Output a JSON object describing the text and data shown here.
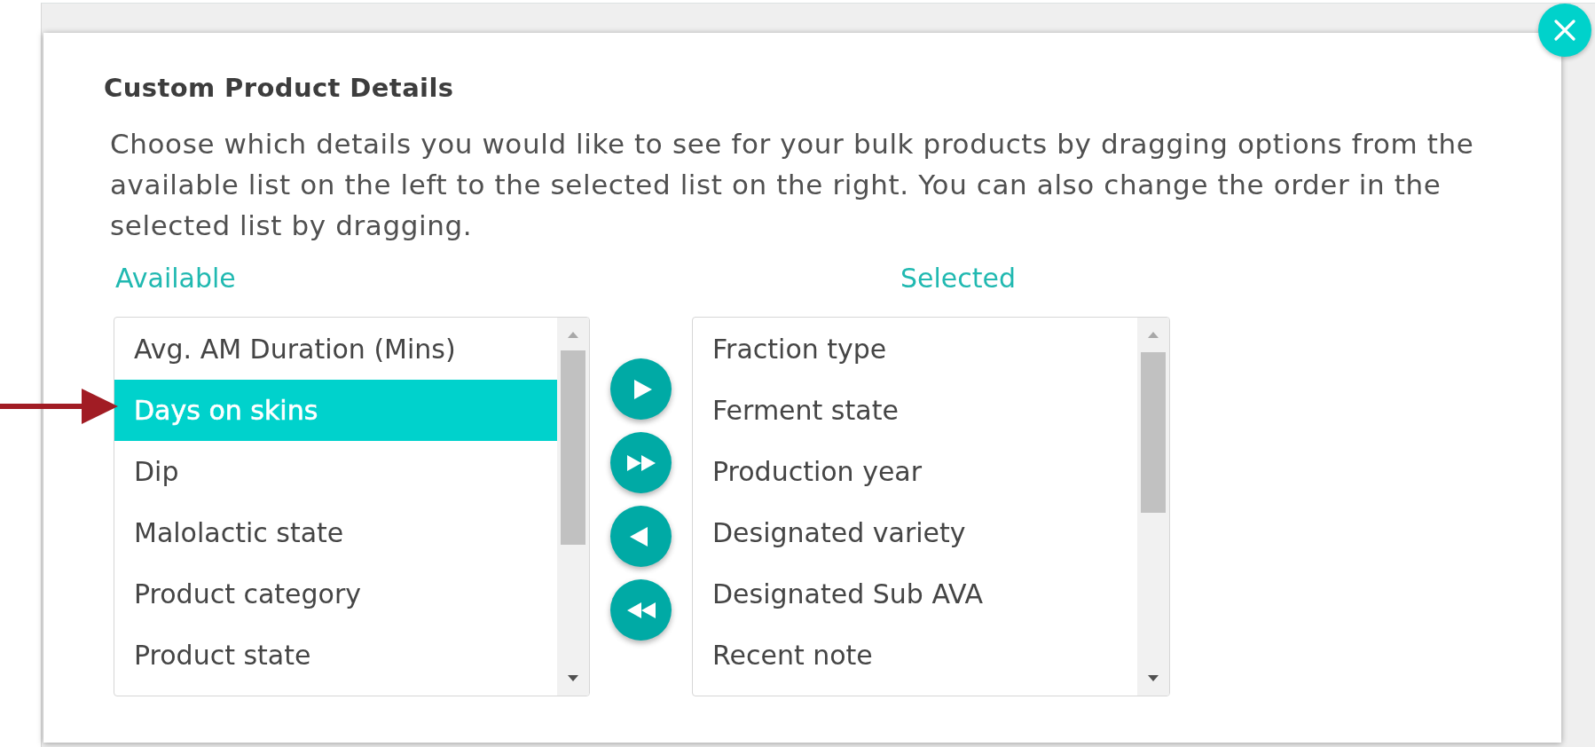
{
  "dialog": {
    "title": "Custom Product Details",
    "description": "Choose which details you would like to see for your bulk products by dragging options from the available list on the left to the selected list on the right. You can also change the order in the selected list by dragging."
  },
  "lists": [
    {
      "heading": "Available",
      "items": [
        {
          "label": "Avg. AM Duration (Mins)",
          "selected": false
        },
        {
          "label": "Days on skins",
          "selected": true
        },
        {
          "label": "Dip",
          "selected": false
        },
        {
          "label": "Malolactic state",
          "selected": false
        },
        {
          "label": "Product category",
          "selected": false
        },
        {
          "label": "Product state",
          "selected": false
        }
      ]
    },
    {
      "heading": "Selected",
      "items": [
        {
          "label": "Fraction type",
          "selected": false
        },
        {
          "label": "Ferment state",
          "selected": false
        },
        {
          "label": "Production year",
          "selected": false
        },
        {
          "label": "Designated variety",
          "selected": false
        },
        {
          "label": "Designated Sub AVA",
          "selected": false
        },
        {
          "label": "Recent note",
          "selected": false
        }
      ]
    }
  ]
}
